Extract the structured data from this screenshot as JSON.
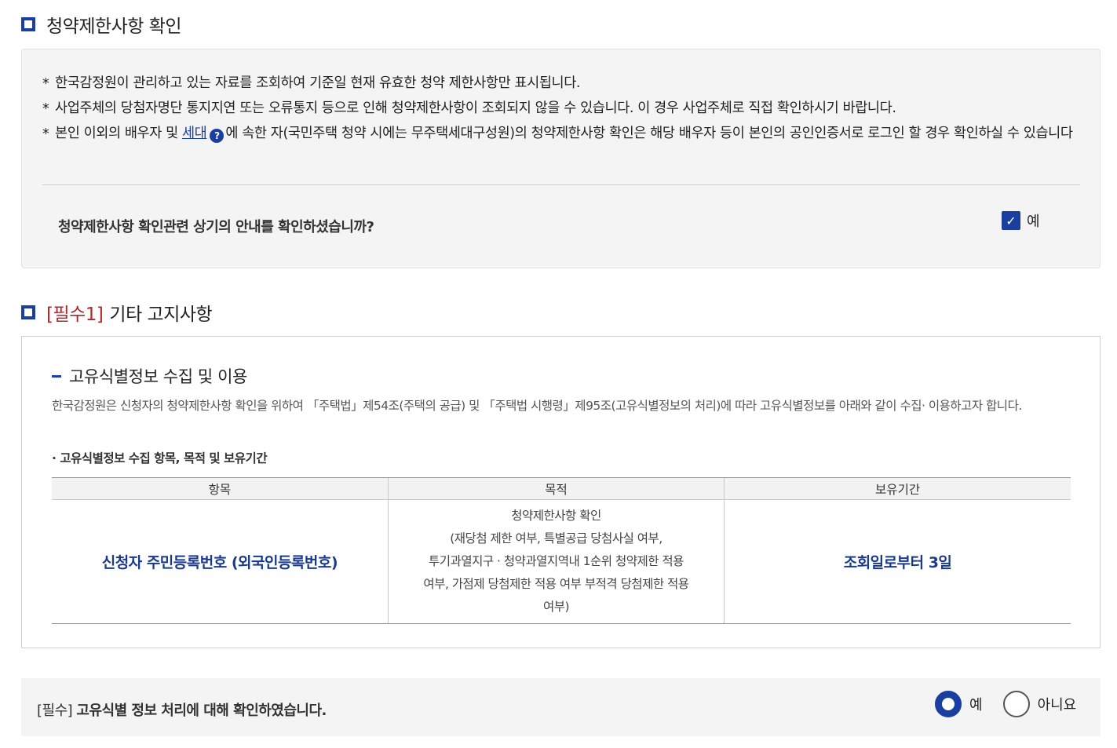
{
  "section1": {
    "title": "청약제한사항 확인",
    "notices": {
      "n1": "한국감정원이 관리하고 있는 자료를 조회하여 기준일 현재 유효한 청약 제한사항만 표시됩니다.",
      "n2": "사업주체의 당첨자명단 통지지연 또는 오류통지 등으로 인해 청약제한사항이 조회되지 않을 수 있습니다. 이 경우 사업주체로 직접 확인하시기 바랍니다.",
      "n3_before": "본인 이외의 배우자 및 ",
      "n3_link": "세대",
      "n3_help": "?",
      "n3_after": "에 속한 자(국민주택 청약 시에는 무주택세대구성원)의 청약제한사항 확인은 해당 배우자 등이 본인의 공인인증서로 로그인 할 경우 확인하실 수 있습니다"
    },
    "confirm_question": "청약제한사항 확인관련 상기의 안내를 확인하셨습니까?",
    "confirm_checkbox": {
      "label": "예",
      "checked": true
    }
  },
  "section2": {
    "title_req": "[필수1]",
    "title": "기타 고지사항",
    "subtitle": "고유식별정보 수집 및 이용",
    "description": "한국감정원은 신청자의 청약제한사항 확인을 위하여 「주택법」제54조(주택의 공급) 및 「주택법 시행령」제95조(고유식별정보의 처리)에 따라 고유식별정보를 아래와 같이 수집· 이용하고자 합니다.",
    "bullet_heading": "· 고유식별정보 수집 항목, 목적 및 보유기간",
    "table": {
      "headers": {
        "item": "항목",
        "purpose": "목적",
        "retention": "보유기간"
      },
      "row": {
        "item": "신청자 주민등록번호 (외국인등록번호)",
        "purpose_line1": "청약제한사항 확인",
        "purpose_line2": "(재당첨 제한 여부, 특별공급 당첨사실 여부,",
        "purpose_line3": "투기과열지구 · 청약과열지역내 1순위 청약제한 적용",
        "purpose_line4": "여부, 가점제 당첨제한 적용 여부 부적격 당첨제한 적용",
        "purpose_line5": "여부)",
        "retention": "조회일로부터 3일"
      }
    }
  },
  "final_confirm": {
    "req_tag": "[필수]",
    "question": "고유식별 정보 처리에 대해 확인하였습니다.",
    "options": {
      "yes": "예",
      "no": "아니요"
    },
    "selected": "yes"
  },
  "colors": {
    "accent": "#1a3fa0",
    "required": "#b3262a",
    "box_bg": "#f4f4f4"
  }
}
